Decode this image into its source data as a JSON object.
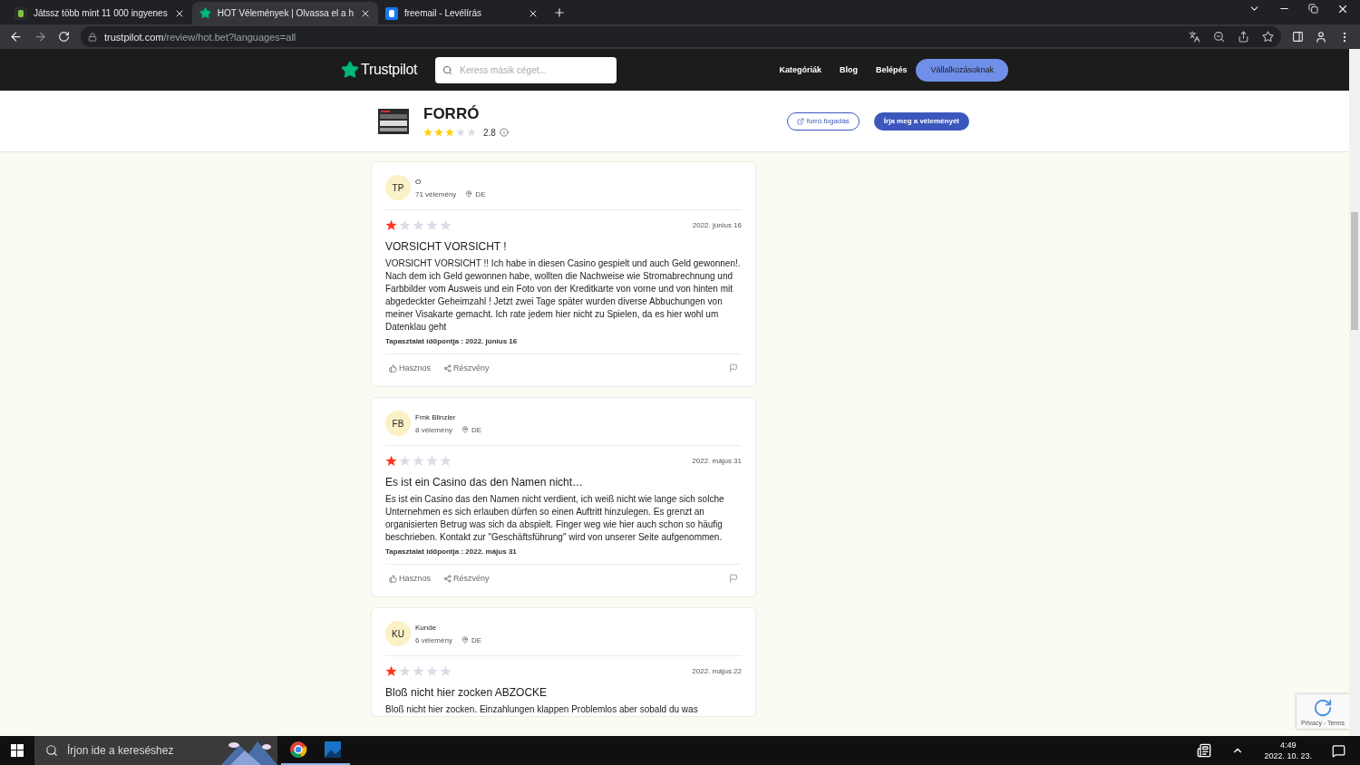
{
  "browser": {
    "tabs": [
      {
        "title": "Játssz több mint 11 000 ingyenes",
        "selected": false
      },
      {
        "title": "HOT Vélemények | Olvassa el a h",
        "selected": true
      },
      {
        "title": "freemail - Levélírás",
        "selected": false
      }
    ],
    "address": {
      "host": "trustpilot.com",
      "path": "/review/hot.bet?languages=all"
    }
  },
  "header": {
    "logo": "Trustpilot",
    "search": {
      "placeholder": "Keress másik céget..."
    },
    "nav": [
      "Kategóriák",
      "Blog",
      "Belépés"
    ],
    "business_button": "Vállalkozásoknak"
  },
  "company": {
    "name": "FORRÓ",
    "stars": 3,
    "score": "2.8",
    "website": "forró.fogadás",
    "write_button": "Írja meg a véleményét"
  },
  "reviews": [
    {
      "initials": "TP",
      "name": "O",
      "count": "71 vélemény",
      "country": "DE",
      "stars": 1,
      "date": "2022. június 16",
      "title": "VORSICHT VORSICHT !",
      "body": "VORSICHT VORSICHT !! Ich habe in diesen Casino gespielt und auch Geld gewonnen!. Nach dem ich Geld gewonnen habe, wollten die Nachweise wie Stromabrechnung und Farbbilder vom Ausweis und ein Foto von der Kreditkarte von vorne und von hinten mit abgedeckter Geheimzahl ! Jetzt zwei Tage später wurden diverse Abbuchungen von meiner Visakarte gemacht. Ich rate jedem hier nicht zu Spielen, da es hier wohl um Datenklau geht",
      "experience": "Tapasztalat időpontja : 2022. június 16",
      "actions": [
        "Hasznos",
        "Részvény"
      ]
    },
    {
      "initials": "FB",
      "name": "Frnk Blinzler",
      "count": "8 vélemény",
      "country": "DE",
      "stars": 1,
      "date": "2022. május 31",
      "title": "Es ist ein Casino das den Namen nicht…",
      "body": "Es ist ein Casino das den Namen nicht verdient, ich weiß nicht wie lange sich solche Unternehmen es sich erlauben dürfen so einen Auftritt hinzulegen. Es grenzt an organisierten Betrug was sich da abspielt. Finger weg wie hier auch schon so häufig beschrieben. Kontakt zur \"Geschäftsführung\" wird von unserer Seite aufgenommen.",
      "experience": "Tapasztalat időpontja : 2022. május 31",
      "actions": [
        "Hasznos",
        "Részvény"
      ]
    },
    {
      "initials": "KU",
      "name": "Kunde",
      "count": "6 vélemény",
      "country": "DE",
      "stars": 1,
      "date": "2022. május 22",
      "title": "Bloß nicht hier zocken ABZOCKE",
      "body": "Bloß nicht hier zocken. Einzahlungen klappen Problemlos aber sobald du was"
    }
  ],
  "recaptcha": {
    "text": "Privacy - Terms"
  },
  "taskbar": {
    "search": {
      "placeholder": "Írjon ide a kereséshez"
    },
    "time": "4:49",
    "date": "2022. 10. 23."
  }
}
